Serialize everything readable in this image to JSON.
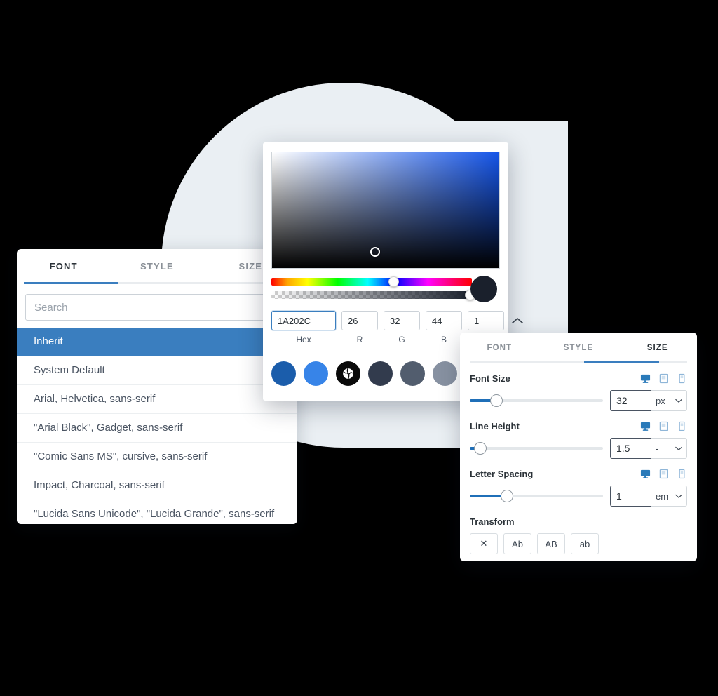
{
  "font_panel": {
    "tabs": [
      {
        "label": "FONT",
        "active": true
      },
      {
        "label": "STYLE",
        "active": false
      },
      {
        "label": "SIZE",
        "active": false
      }
    ],
    "search": {
      "value": "",
      "placeholder": "Search"
    },
    "items": [
      {
        "label": "Inherit",
        "selected": true
      },
      {
        "label": "System Default",
        "selected": false
      },
      {
        "label": "Arial, Helvetica, sans-serif",
        "selected": false
      },
      {
        "label": "\"Arial Black\", Gadget, sans-serif",
        "selected": false
      },
      {
        "label": "\"Comic Sans MS\", cursive, sans-serif",
        "selected": false
      },
      {
        "label": "Impact, Charcoal, sans-serif",
        "selected": false
      },
      {
        "label": "\"Lucida Sans Unicode\", \"Lucida Grande\", sans-serif",
        "selected": false
      }
    ],
    "selected_color": "#3a7ebf"
  },
  "color_panel": {
    "current_color": "#1A202C",
    "fields": [
      {
        "name": "hex",
        "value": "1A202C",
        "label": "Hex"
      },
      {
        "name": "r",
        "value": "26",
        "label": "R"
      },
      {
        "name": "g",
        "value": "32",
        "label": "G"
      },
      {
        "name": "b",
        "value": "44",
        "label": "B"
      },
      {
        "name": "a",
        "value": "1",
        "label": ""
      }
    ],
    "hue_position_pct": 58,
    "alpha_position_pct": 100,
    "sv_cursor": {
      "x_pct": 43,
      "y_pct": 82
    },
    "swatches": [
      {
        "color": "#1B5DAB",
        "kind": "solid"
      },
      {
        "color": "#3784E8",
        "kind": "solid"
      },
      {
        "color": "#0A0A0A",
        "kind": "globe"
      },
      {
        "color": "#323B4D",
        "kind": "solid"
      },
      {
        "color": "#525D6E",
        "kind": "solid"
      },
      {
        "color": "#8791A1",
        "kind": "solid"
      },
      {
        "color": "#EDF1F5",
        "kind": "bordered"
      },
      {
        "color": "#F4F7FA",
        "kind": "bordered"
      }
    ]
  },
  "size_panel": {
    "tabs": [
      {
        "label": "FONT",
        "active": false
      },
      {
        "label": "STYLE",
        "active": false
      },
      {
        "label": "SIZE",
        "active": true
      }
    ],
    "controls": [
      {
        "label": "Font Size",
        "value": "32",
        "unit": "px",
        "fill_pct": 20,
        "devices": [
          "desktop-icon",
          "tablet-icon",
          "mobile-icon"
        ],
        "active_device": "desktop-icon"
      },
      {
        "label": "Line Height",
        "value": "1.5",
        "unit": "-",
        "fill_pct": 8,
        "devices": [
          "desktop-icon",
          "tablet-icon",
          "mobile-icon"
        ],
        "active_device": "desktop-icon"
      },
      {
        "label": "Letter Spacing",
        "value": "1",
        "unit": "em",
        "fill_pct": 28,
        "devices": [
          "desktop-icon",
          "tablet-icon",
          "mobile-icon"
        ],
        "active_device": "desktop-icon"
      }
    ],
    "transform": {
      "label": "Transform",
      "buttons": [
        {
          "label": "✕",
          "name": "none"
        },
        {
          "label": "Ab",
          "name": "capitalize"
        },
        {
          "label": "AB",
          "name": "uppercase"
        },
        {
          "label": "ab",
          "name": "lowercase"
        }
      ]
    },
    "accent": "#2a7ab9"
  }
}
